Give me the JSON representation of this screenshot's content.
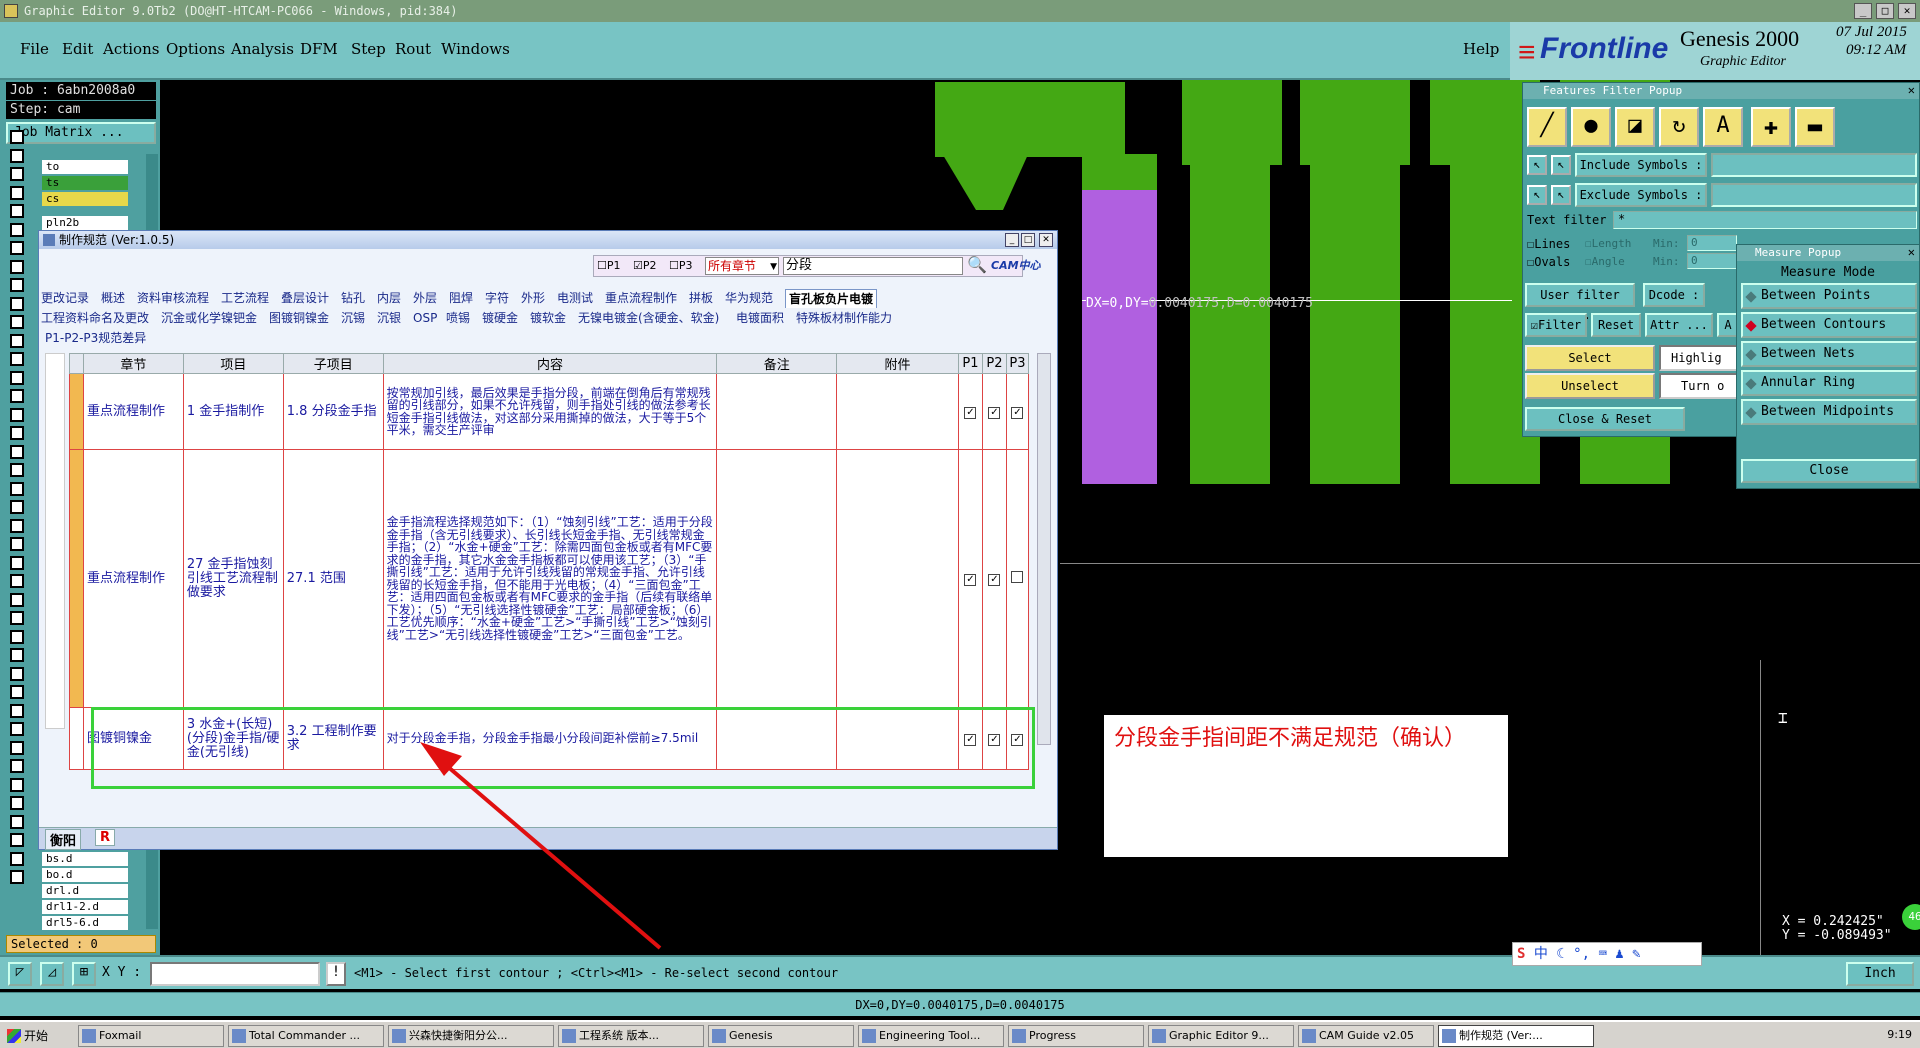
{
  "window": {
    "title": "Graphic Editor 9.0Tb2 (DO@HT-HTCAM-PC066 - Windows, pid:384)"
  },
  "menu": {
    "items": [
      "File",
      "Edit",
      "Actions",
      "Options",
      "Analysis",
      "DFM",
      "Step",
      "Rout",
      "Windows"
    ],
    "help": "Help"
  },
  "brand": {
    "logo": "Frontline",
    "product": "Genesis 2000",
    "subtitle": "Graphic Editor",
    "date": "07 Jul 2015",
    "time": "09:12 AM"
  },
  "job": {
    "job_line": "Job : 6abn2008a0",
    "step_line": "Step: cam",
    "matrix_button": "Job Matrix ...",
    "layers_top": [
      "to",
      "ts",
      "cs",
      "pln2b"
    ],
    "layers_bottom": [
      "bs.d",
      "bo.d",
      "drl.d",
      "drl1-2.d",
      "drl5-6.d"
    ],
    "selected": "Selected : 0"
  },
  "features": {
    "title": "Features Filter Popup",
    "include": "Include Symbols :",
    "exclude": "Exclude Symbols :",
    "text_filter": "Text filter",
    "text_filter_value": "*",
    "lines": "Lines",
    "ovals": "Ovals",
    "length": "Length",
    "angle": "Angle",
    "min": "Min:",
    "min_value": "0",
    "user_filter": "User filter ...",
    "dcode": "Dcode :",
    "filter": "Filter",
    "reset": "Reset",
    "attr": "Attr ...",
    "select": "Select",
    "unselect": "Unselect",
    "highlight": "Highlig",
    "turn": "Turn o",
    "close_reset": "Close & Reset",
    "a_btn": "A"
  },
  "measure": {
    "title": "Measure Popup",
    "mode": "Measure Mode",
    "options": [
      "Between Points",
      "Between Contours",
      "Between Nets",
      "Annular Ring",
      "Between Midpoints"
    ],
    "selected_index": 1,
    "close": "Close"
  },
  "canvas": {
    "measure_label_a": "DX=0,DY=",
    "measure_label_b": "0.0040175,D=0.0040175",
    "coord_x": "X = 0.242425\"",
    "coord_y": "Y = -0.089493\"",
    "badge": "46"
  },
  "dialog": {
    "title": "制作规范 (Ver:1.0.5)",
    "filter_p1": "P1",
    "filter_p2": "P2",
    "filter_p3": "P3",
    "chapter_select": "所有章节",
    "search_value": "分段",
    "cam_logo": "CAM中心",
    "tabs_row1": [
      "更改记录",
      "概述",
      "资料审核流程",
      "工艺流程",
      "叠层设计",
      "钻孔",
      "内层",
      "外层",
      "阻焊",
      "字符",
      "外形",
      "电测试",
      "重点流程制作",
      "拼板",
      "华为规范",
      "盲孔板负片电镀"
    ],
    "tabs_row2": [
      "工程资料命名及更改",
      "沉金或化学镍钯金",
      "图镀铜镍金",
      "沉锡",
      "沉银",
      "OSP",
      "喷锡",
      "镀硬金",
      "镀软金",
      "无镍电镀金(含硬金、软金)",
      "电镀面积",
      "特殊板材制作能力"
    ],
    "tabs_row3": [
      "P1-P2-P3规范差异"
    ],
    "columns": [
      "章节",
      "项目",
      "子项目",
      "内容",
      "备注",
      "附件",
      "P1",
      "P2",
      "P3"
    ],
    "rows": [
      {
        "chapter": "重点流程制作",
        "item": "1 金手指制作",
        "sub": "1.8 分段金手指",
        "content": "按常规加引线，最后效果是手指分段，前端在倒角后有常规残留的引线部分，如果不允许残留，则手指处引线的做法参考长短金手指引线做法，对这部分采用撕掉的做法，大于等于5个平米，需交生产评审",
        "note": "",
        "attach": "",
        "p1": true,
        "p2": true,
        "p3": true
      },
      {
        "chapter": "重点流程制作",
        "item": "27 金手指蚀刻引线工艺流程制做要求",
        "sub": "27.1 范围",
        "content": "金手指流程选择规范如下：（1）“蚀刻引线”工艺：适用于分段金手指（含无引线要求）、长引线长短金手指、无引线常规金手指；（2）“水金+硬金”工艺：除需四面包金板或者有MFC要求的金手指，其它水金金手指板都可以使用该工艺；（3）“手撕引线”工艺：适用于允许引线残留的常规金手指、允许引线残留的长短金手指，但不能用于光电板；（4）“三面包金”工艺：适用四面包金板或者有MFC要求的金手指（后续有联络单下发）；（5）“无引线选择性镀硬金”工艺：局部硬金板；（6）工艺优先顺序：“水金+硬金”工艺>“手撕引线”工艺>“蚀刻引线”工艺>“无引线选择性镀硬金”工艺>“三面包金”工艺。",
        "note": "",
        "attach": "",
        "p1": true,
        "p2": true,
        "p3": false
      },
      {
        "chapter": "图镀铜镍金",
        "item": "3 水金+(长短)(分段)金手指/硬金(无引线)",
        "sub": "3.2 工程制作要求",
        "content": "对于分段金手指，分段金手指最小分段间距补偿前≥7.5mil",
        "note": "",
        "attach": "",
        "p1": true,
        "p2": true,
        "p3": true
      }
    ],
    "bottom_tabs": [
      "衡阳",
      "R"
    ]
  },
  "note": {
    "text": "分段金手指间距不满足规范（确认）"
  },
  "command": {
    "xy_label": "X Y :",
    "xy_value": "",
    "prompt": "<M1> - Select first contour ; <Ctrl><M1> - Re-select second contour",
    "units": "Inch"
  },
  "status": {
    "text": "DX=0,DY=0.0040175,D=0.0040175"
  },
  "ime": {
    "label": "中"
  },
  "taskbar": {
    "start": "开始",
    "items": [
      "Foxmail",
      "Total Commander ...",
      "兴森快捷衡阳分公...",
      "工程系统 版本...",
      "Genesis",
      "Engineering Tool...",
      "Progress",
      "Graphic Editor 9...",
      "CAM Guide v2.05",
      "制作规范 (Ver:..."
    ],
    "active_index": 9,
    "clock": "9:19"
  },
  "colors": {
    "teal": "#78c4c4",
    "green_feature": "#44a814",
    "purple_feature": "#b060e0",
    "annotation_red": "#e01010",
    "highlight_green": "#3ad13a"
  }
}
